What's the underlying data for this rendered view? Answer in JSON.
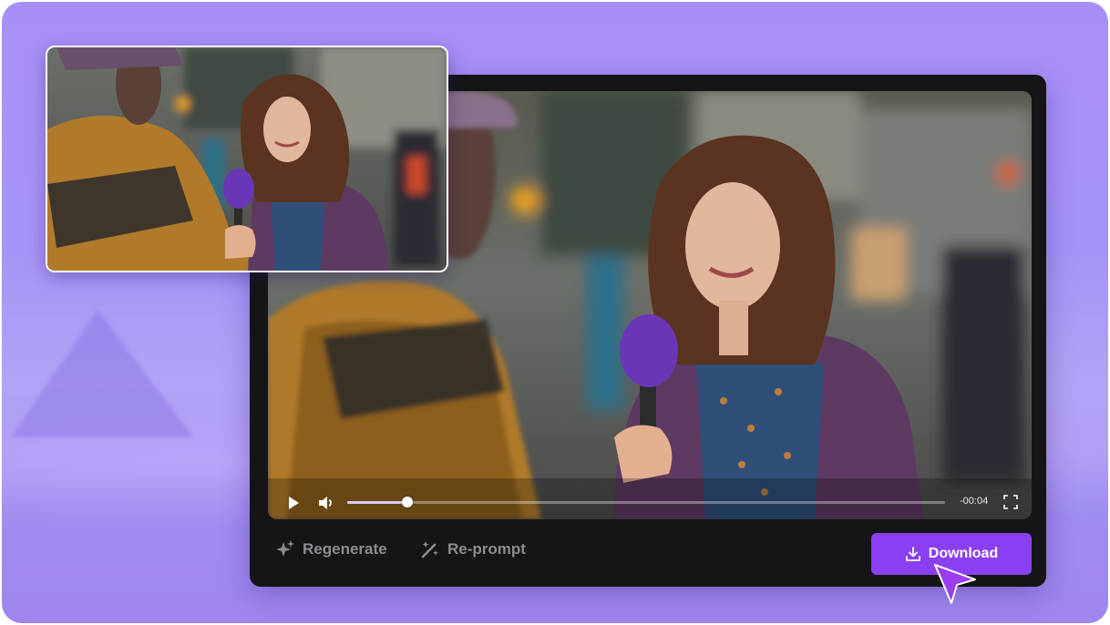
{
  "video_player": {
    "time_remaining": "-00:04",
    "progress": 0.1,
    "icons": {
      "play": "play-icon",
      "volume": "volume-icon",
      "fullscreen": "fullscreen-icon"
    }
  },
  "actions": {
    "regenerate_label": "Regenerate",
    "reprompt_label": "Re-prompt",
    "download_label": "Download"
  },
  "colors": {
    "accent": "#8b3ff2",
    "background": "#a793f7",
    "panel": "#151517"
  }
}
